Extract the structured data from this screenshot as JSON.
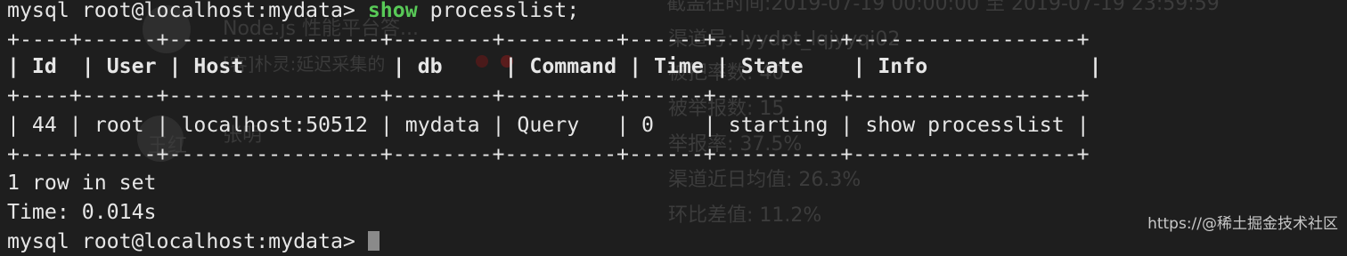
{
  "background": {
    "top_right_fragment": "截盖往时间:2019-07-19 00:00:00 至 2019-07-19 23:59:59",
    "items": [
      {
        "text": "Node.js 性能平台答..."
      },
      {
        "text": "[客]朴灵:延迟采集的"
      },
      {
        "text": "王红"
      },
      {
        "text": "张明"
      },
      {
        "text": "渠道号: lyydpt_lqjyyqi02"
      },
      {
        "text": "被把率数: 40"
      },
      {
        "text": "被举报数: 15"
      },
      {
        "text": "举报率: 37.5%"
      },
      {
        "text": "渠道近日均值: 26.3%"
      },
      {
        "text": "环比差值: 11.2%"
      }
    ]
  },
  "terminal": {
    "prompt": "mysql root@localhost:mydata> ",
    "command_keyword": "show",
    "command_rest": " processlist;",
    "border": "+----+------+-----------------+--------+---------+------+----------+------------------+",
    "header_cells": [
      "Id",
      "User",
      "Host",
      "db",
      "Command",
      "Time",
      "State",
      "Info"
    ],
    "row_cells": [
      "44",
      "root",
      "localhost:50512",
      "mydata",
      "Query",
      "0",
      "starting",
      "show processlist"
    ],
    "summary": "1 row in set",
    "time": "Time: 0.014s",
    "next_prompt": "mysql root@localhost:mydata> "
  },
  "watermark": "https://@稀土掘金技术社区"
}
